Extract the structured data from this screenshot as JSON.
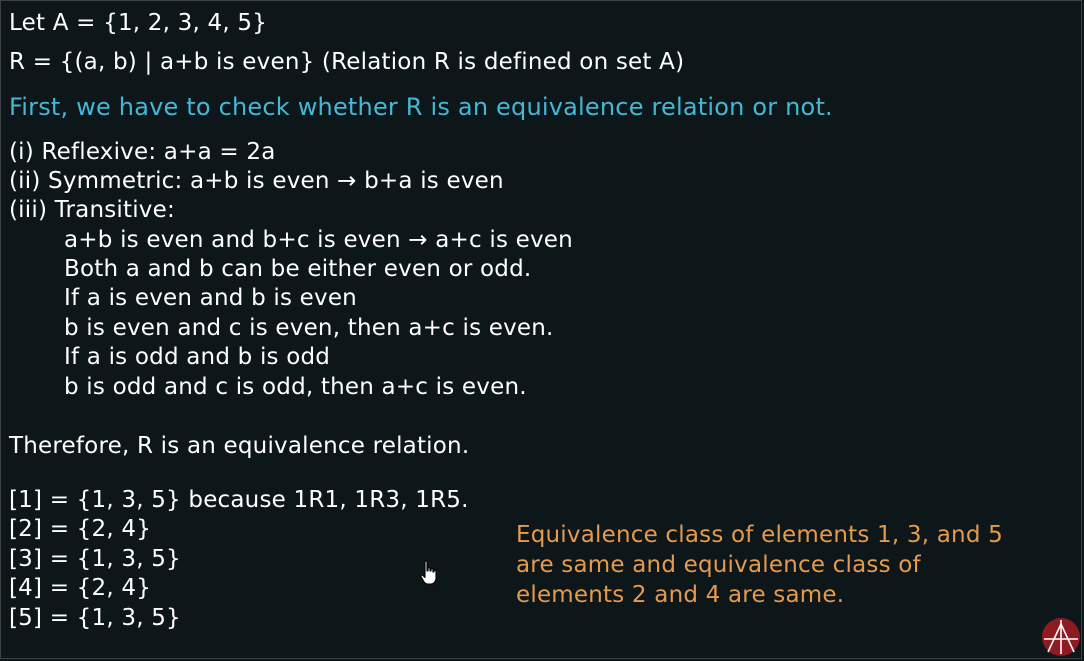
{
  "lines": [
    "Let A = {1, 2, 3, 4, 5}",
    "R = {(a, b) | a+b is even}    (Relation R is defined on set A)",
    "First, we have to check whether R is an equivalence relation or not.",
    "(i) Reflexive:   a+a = 2a",
    "(ii) Symmetric:   a+b is even → b+a is even",
    "(iii) Transitive:",
    "a+b is even and b+c is even → a+c is even",
    "Both a and b can be either even or odd.",
    "If a is even and b is even",
    "b is even and c is even, then a+c is even.",
    "If a is odd and b is odd",
    "b is odd and c is odd, then a+c is even.",
    "Therefore, R is an equivalence relation.",
    "[1] = {1, 3, 5}  because 1R1, 1R3, 1R5.",
    "[2] = {2, 4}",
    "[3] = {1, 3, 5}",
    "[4] = {2, 4}",
    "[5] = {1, 3, 5}"
  ],
  "note": [
    "Equivalence class of elements 1, 3, and 5",
    "are same and equivalence class of",
    "elements 2 and 4 are same."
  ],
  "colors": {
    "background": "#0d1619",
    "text": "#ffffff",
    "highlight": "#45b7d6",
    "note": "#e59a4e"
  },
  "icons": [
    "hand-cursor-icon",
    "channel-logo-icon"
  ]
}
